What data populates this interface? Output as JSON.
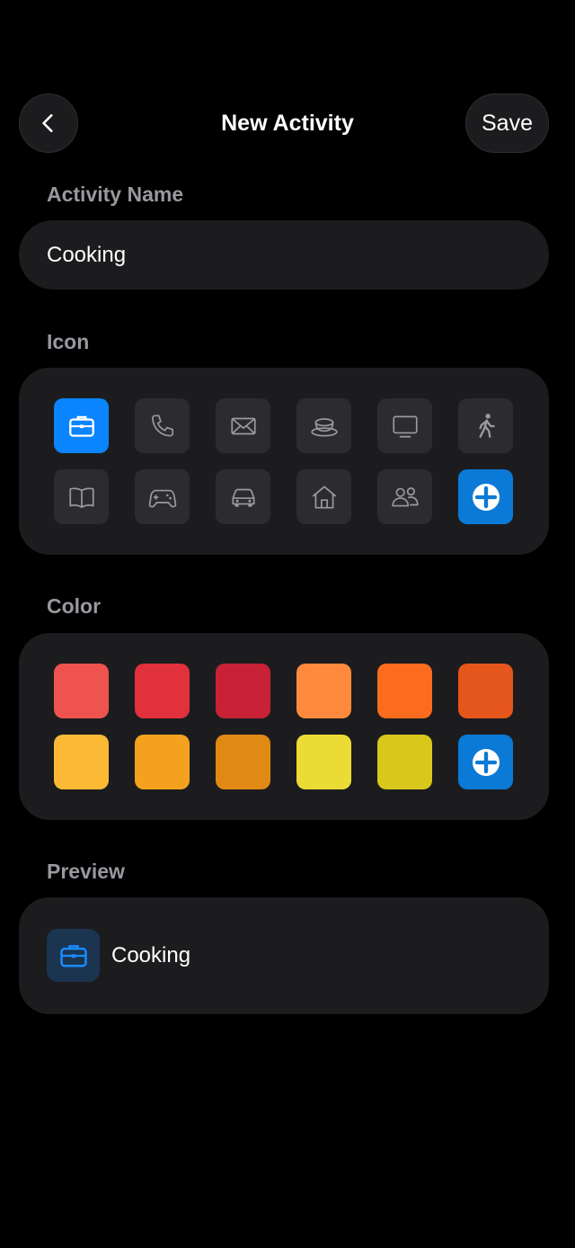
{
  "header": {
    "title": "New Activity",
    "save_label": "Save",
    "back_icon": "chevron-left-icon"
  },
  "name_section": {
    "label": "Activity Name",
    "value": "Cooking"
  },
  "icon_section": {
    "label": "Icon",
    "selected": "briefcase-icon",
    "icons": [
      "briefcase-icon",
      "phone-icon",
      "envelope-icon",
      "cup-icon",
      "monitor-icon",
      "walking-icon",
      "book-icon",
      "gamepad-icon",
      "car-icon",
      "house-icon",
      "people-icon",
      "add-icon"
    ]
  },
  "color_section": {
    "label": "Color",
    "colors": [
      "#ef5350",
      "#e0313c",
      "#c92237",
      "#ff8a3d",
      "#fb6c1e",
      "#e4561b",
      "#fbb935",
      "#f4a11f",
      "#e08914",
      "#ebdc35",
      "#d8c81b"
    ],
    "add_color": "#0a7ad6"
  },
  "preview_section": {
    "label": "Preview",
    "name": "Cooking",
    "icon": "briefcase-icon",
    "icon_color": "#1a8cff",
    "icon_bg": "#1b3450"
  },
  "accent": "#0a84ff"
}
